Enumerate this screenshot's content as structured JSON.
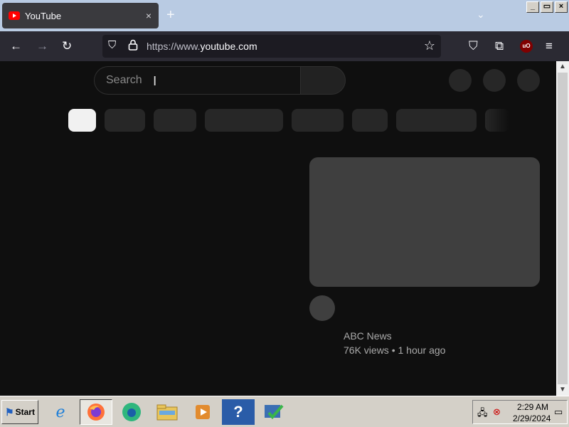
{
  "browser": {
    "tab": {
      "title": "YouTube",
      "favicon": "youtube-logo-icon",
      "close": "×"
    },
    "new_tab": "+",
    "tab_list": "⌄",
    "window_controls": {
      "minimize": "_",
      "restore": "▭",
      "close": "×"
    },
    "nav": {
      "back": "←",
      "forward": "→",
      "reload": "↻"
    },
    "url": {
      "prefix": "https://www.",
      "domain": "youtube.com"
    },
    "extensions": {
      "ublock_label": "uO"
    },
    "icons": {
      "shield": "⛉",
      "lock": "🔒",
      "star": "☆",
      "pocket": "⛉",
      "extensions": "⧉",
      "menu": "≡"
    }
  },
  "page": {
    "search": {
      "placeholder": "Search"
    },
    "video": {
      "channel": "ABC News",
      "meta": "76K views • 1 hour ago"
    }
  },
  "taskbar": {
    "start_label": "Start",
    "apps": [
      "internet-explorer-icon",
      "firefox-icon",
      "edge-icon",
      "file-explorer-icon",
      "media-player-icon",
      "help-icon",
      "tasks-icon"
    ],
    "clock": {
      "time": "2:29 AM",
      "date": "2/29/2024"
    }
  },
  "colors": {
    "accent_red": "#ff0000",
    "page_bg": "#0f0f0f",
    "skeleton": "#272727",
    "toolbar": "#2b2a33"
  }
}
